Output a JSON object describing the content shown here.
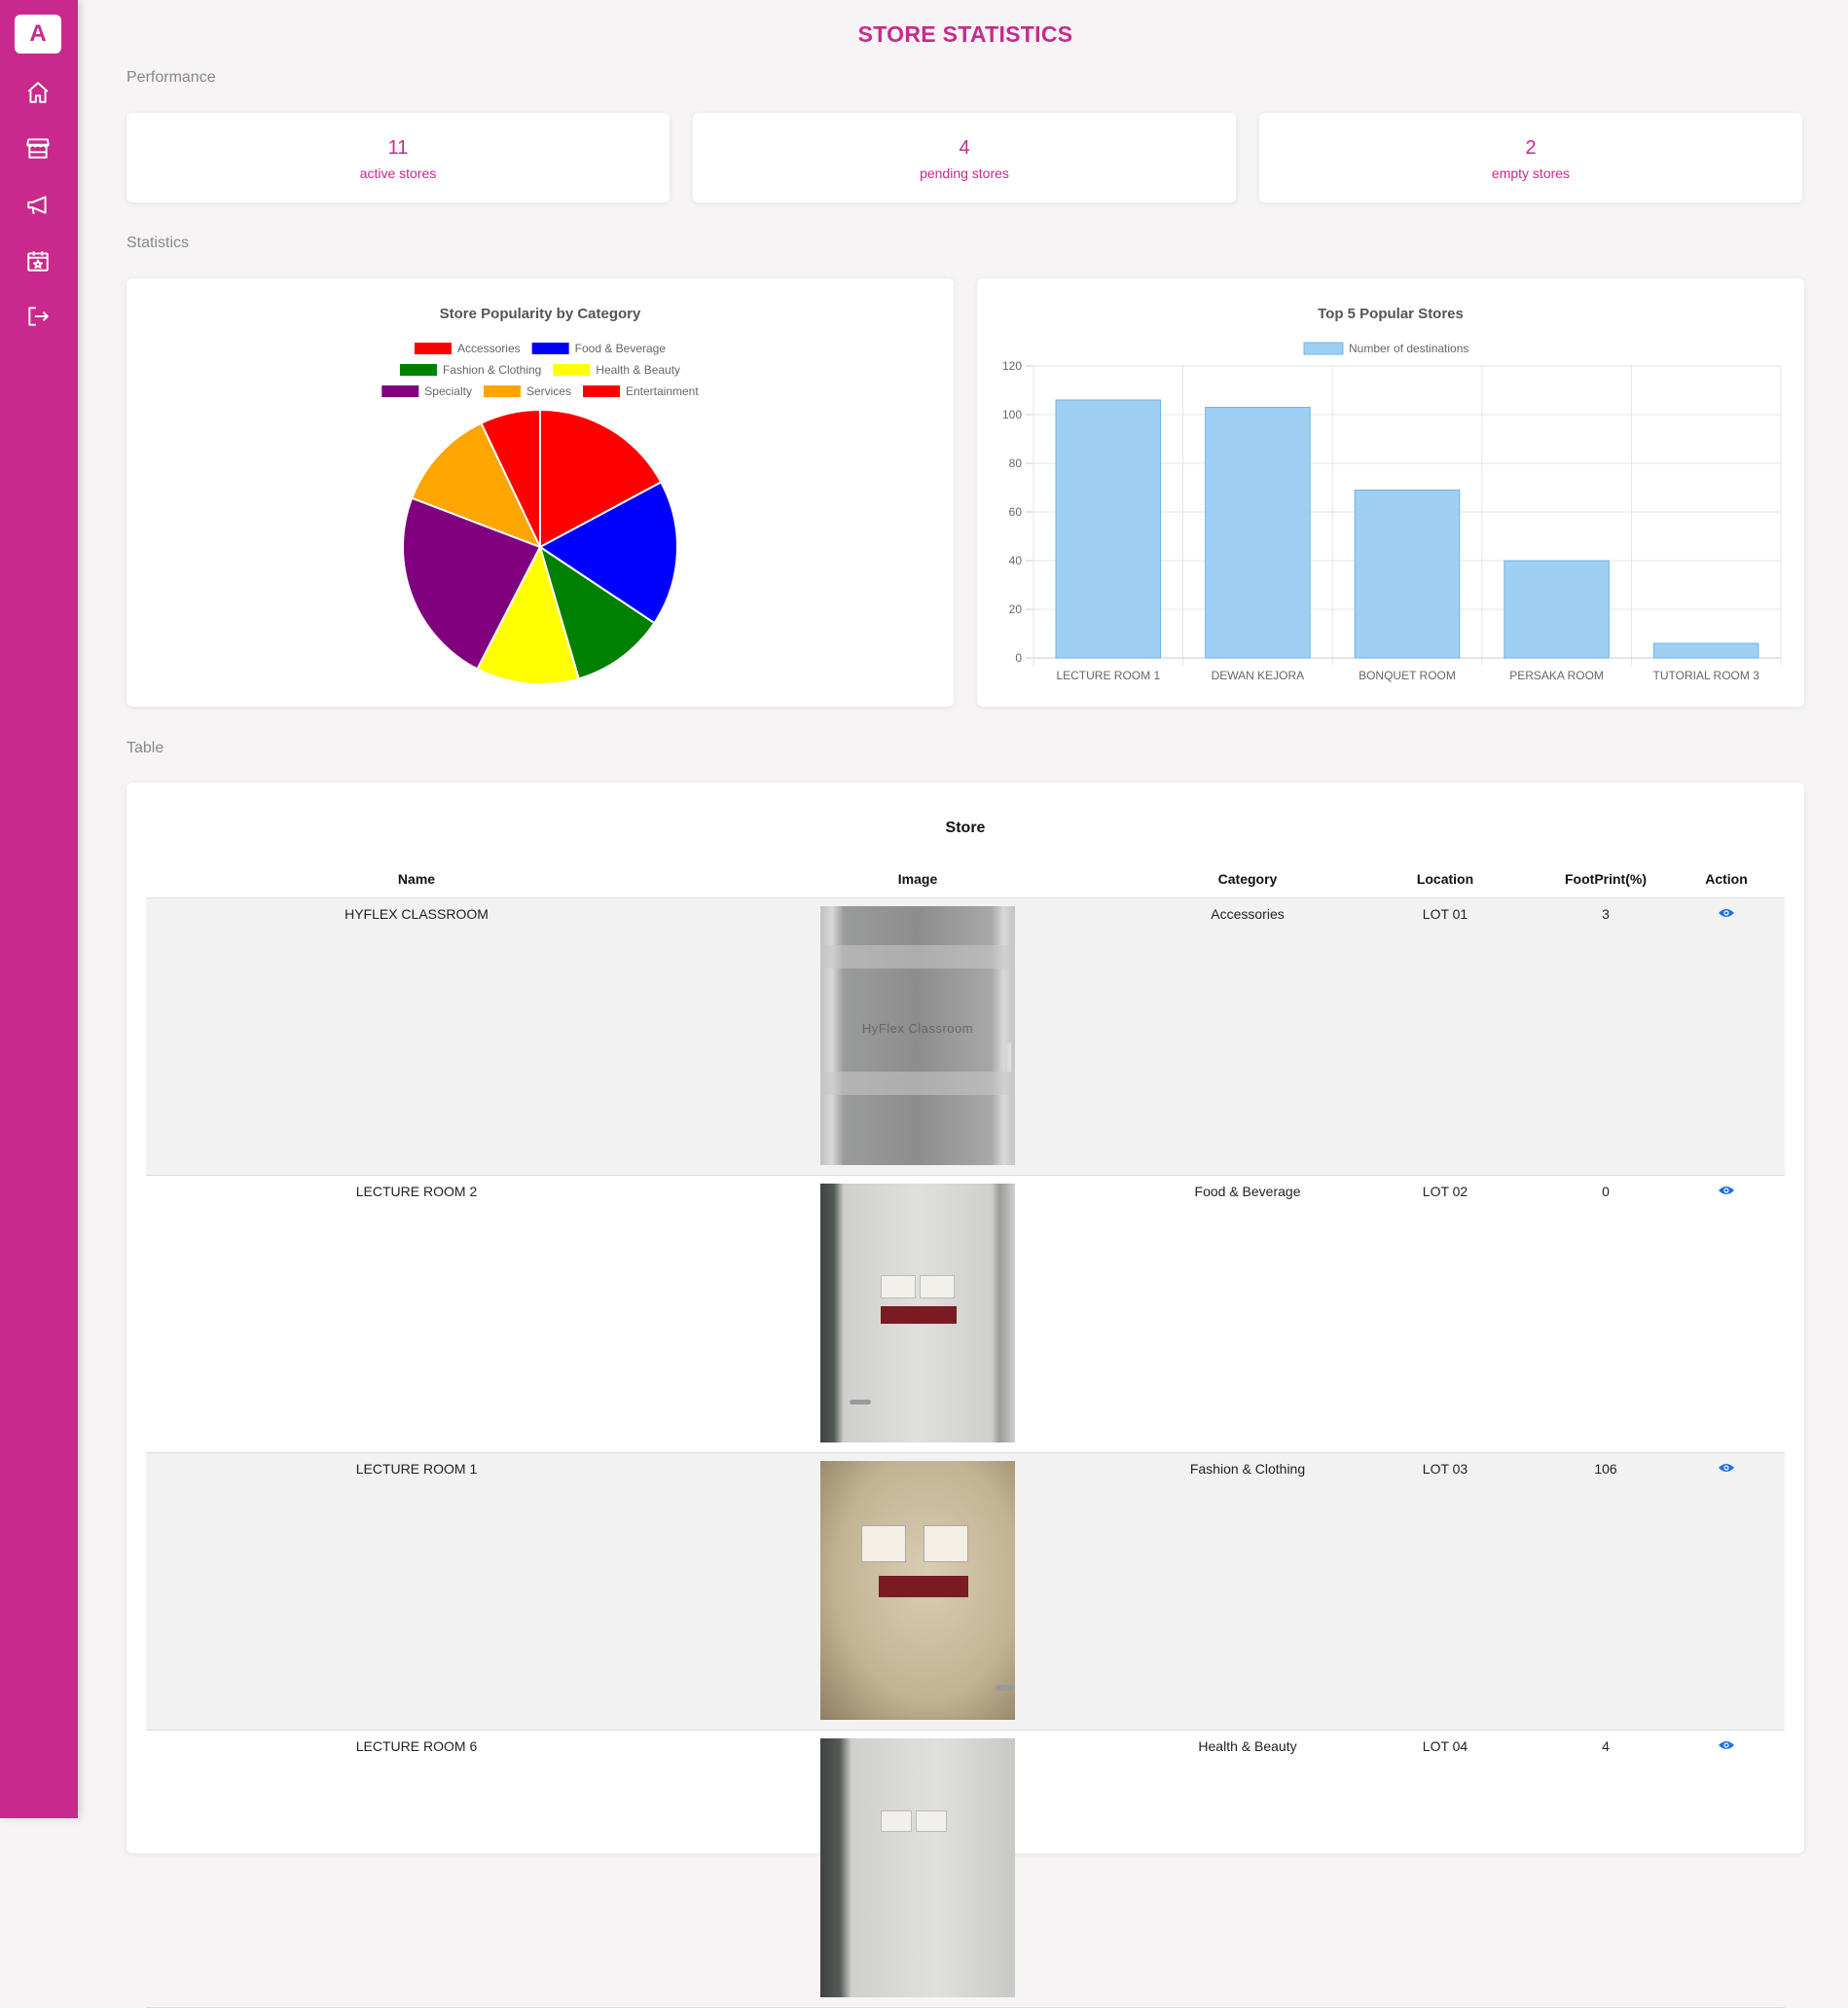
{
  "app": {
    "logo_letter": "A",
    "accent": "#c9298c"
  },
  "sidebar": {
    "items": [
      {
        "icon": "home-icon"
      },
      {
        "icon": "store-icon"
      },
      {
        "icon": "megaphone-icon"
      },
      {
        "icon": "calendar-star-icon"
      },
      {
        "icon": "logout-icon"
      }
    ]
  },
  "page_title": "STORE STATISTICS",
  "sections": {
    "performance": "Performance",
    "statistics": "Statistics",
    "table": "Table"
  },
  "performance": [
    {
      "value": "11",
      "label": "active stores"
    },
    {
      "value": "4",
      "label": "pending stores"
    },
    {
      "value": "2",
      "label": "empty stores"
    }
  ],
  "chart_data": [
    {
      "type": "pie",
      "title": "Store Popularity by Category",
      "categories": [
        "Accessories",
        "Food & Beverage",
        "Fashion & Clothing",
        "Health & Beauty",
        "Specialty",
        "Services",
        "Entertainment"
      ],
      "values": [
        17,
        17,
        11,
        12,
        23,
        12,
        7
      ],
      "colors": [
        "#ff0000",
        "#0000ff",
        "#008000",
        "#ffff00",
        "#800080",
        "#ffa500",
        "#ff0000"
      ],
      "legend": "top"
    },
    {
      "type": "bar",
      "title": "Top 5 Popular Stores",
      "categories": [
        "LECTURE ROOM 1",
        "DEWAN KEJORA",
        "BONQUET ROOM",
        "PERSAKA ROOM",
        "TUTORIAL ROOM 3"
      ],
      "series": [
        {
          "name": "Number of destinations",
          "values": [
            106,
            103,
            69,
            40,
            6
          ]
        }
      ],
      "ylim": [
        0,
        120
      ],
      "yticks": [
        0,
        20,
        40,
        60,
        80,
        100,
        120
      ],
      "grid": true,
      "legend": "top",
      "bar_color": "#9fcff3",
      "bar_border": "#6bb5e8"
    }
  ],
  "table": {
    "title": "Store",
    "columns": [
      "Name",
      "Image",
      "Category",
      "Location",
      "FootPrint(%)",
      "Action"
    ],
    "rows": [
      {
        "name": "HYFLEX CLASSROOM",
        "category": "Accessories",
        "location": "LOT 01",
        "footprint": "3",
        "image_text": "HyFlex Classroom"
      },
      {
        "name": "LECTURE ROOM 2",
        "category": "Food & Beverage",
        "location": "LOT 02",
        "footprint": "0",
        "image_text": ""
      },
      {
        "name": "LECTURE ROOM 1",
        "category": "Fashion & Clothing",
        "location": "LOT 03",
        "footprint": "106",
        "image_text": ""
      },
      {
        "name": "LECTURE ROOM 6",
        "category": "Health & Beauty",
        "location": "LOT 04",
        "footprint": "4",
        "image_text": ""
      }
    ],
    "action_icon": "eye-icon"
  }
}
